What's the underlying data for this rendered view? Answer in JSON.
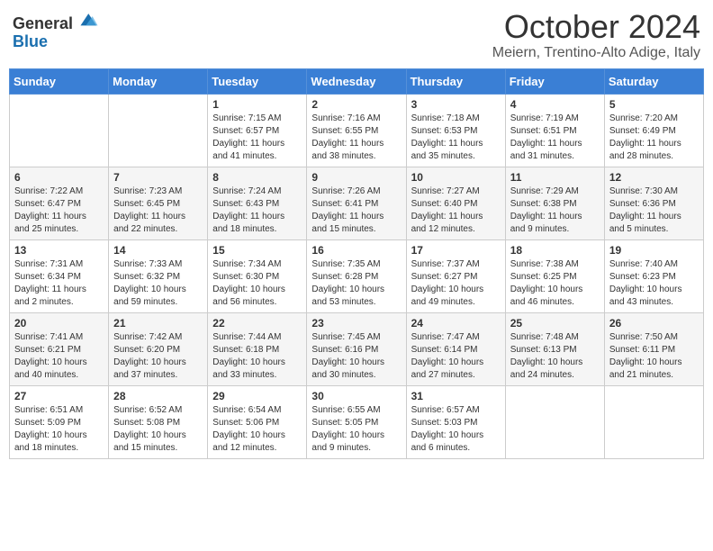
{
  "header": {
    "logo_general": "General",
    "logo_blue": "Blue",
    "month_title": "October 2024",
    "location": "Meiern, Trentino-Alto Adige, Italy"
  },
  "weekdays": [
    "Sunday",
    "Monday",
    "Tuesday",
    "Wednesday",
    "Thursday",
    "Friday",
    "Saturday"
  ],
  "weeks": [
    [
      {
        "day": "",
        "sunrise": "",
        "sunset": "",
        "daylight": ""
      },
      {
        "day": "",
        "sunrise": "",
        "sunset": "",
        "daylight": ""
      },
      {
        "day": "1",
        "sunrise": "Sunrise: 7:15 AM",
        "sunset": "Sunset: 6:57 PM",
        "daylight": "Daylight: 11 hours and 41 minutes."
      },
      {
        "day": "2",
        "sunrise": "Sunrise: 7:16 AM",
        "sunset": "Sunset: 6:55 PM",
        "daylight": "Daylight: 11 hours and 38 minutes."
      },
      {
        "day": "3",
        "sunrise": "Sunrise: 7:18 AM",
        "sunset": "Sunset: 6:53 PM",
        "daylight": "Daylight: 11 hours and 35 minutes."
      },
      {
        "day": "4",
        "sunrise": "Sunrise: 7:19 AM",
        "sunset": "Sunset: 6:51 PM",
        "daylight": "Daylight: 11 hours and 31 minutes."
      },
      {
        "day": "5",
        "sunrise": "Sunrise: 7:20 AM",
        "sunset": "Sunset: 6:49 PM",
        "daylight": "Daylight: 11 hours and 28 minutes."
      }
    ],
    [
      {
        "day": "6",
        "sunrise": "Sunrise: 7:22 AM",
        "sunset": "Sunset: 6:47 PM",
        "daylight": "Daylight: 11 hours and 25 minutes."
      },
      {
        "day": "7",
        "sunrise": "Sunrise: 7:23 AM",
        "sunset": "Sunset: 6:45 PM",
        "daylight": "Daylight: 11 hours and 22 minutes."
      },
      {
        "day": "8",
        "sunrise": "Sunrise: 7:24 AM",
        "sunset": "Sunset: 6:43 PM",
        "daylight": "Daylight: 11 hours and 18 minutes."
      },
      {
        "day": "9",
        "sunrise": "Sunrise: 7:26 AM",
        "sunset": "Sunset: 6:41 PM",
        "daylight": "Daylight: 11 hours and 15 minutes."
      },
      {
        "day": "10",
        "sunrise": "Sunrise: 7:27 AM",
        "sunset": "Sunset: 6:40 PM",
        "daylight": "Daylight: 11 hours and 12 minutes."
      },
      {
        "day": "11",
        "sunrise": "Sunrise: 7:29 AM",
        "sunset": "Sunset: 6:38 PM",
        "daylight": "Daylight: 11 hours and 9 minutes."
      },
      {
        "day": "12",
        "sunrise": "Sunrise: 7:30 AM",
        "sunset": "Sunset: 6:36 PM",
        "daylight": "Daylight: 11 hours and 5 minutes."
      }
    ],
    [
      {
        "day": "13",
        "sunrise": "Sunrise: 7:31 AM",
        "sunset": "Sunset: 6:34 PM",
        "daylight": "Daylight: 11 hours and 2 minutes."
      },
      {
        "day": "14",
        "sunrise": "Sunrise: 7:33 AM",
        "sunset": "Sunset: 6:32 PM",
        "daylight": "Daylight: 10 hours and 59 minutes."
      },
      {
        "day": "15",
        "sunrise": "Sunrise: 7:34 AM",
        "sunset": "Sunset: 6:30 PM",
        "daylight": "Daylight: 10 hours and 56 minutes."
      },
      {
        "day": "16",
        "sunrise": "Sunrise: 7:35 AM",
        "sunset": "Sunset: 6:28 PM",
        "daylight": "Daylight: 10 hours and 53 minutes."
      },
      {
        "day": "17",
        "sunrise": "Sunrise: 7:37 AM",
        "sunset": "Sunset: 6:27 PM",
        "daylight": "Daylight: 10 hours and 49 minutes."
      },
      {
        "day": "18",
        "sunrise": "Sunrise: 7:38 AM",
        "sunset": "Sunset: 6:25 PM",
        "daylight": "Daylight: 10 hours and 46 minutes."
      },
      {
        "day": "19",
        "sunrise": "Sunrise: 7:40 AM",
        "sunset": "Sunset: 6:23 PM",
        "daylight": "Daylight: 10 hours and 43 minutes."
      }
    ],
    [
      {
        "day": "20",
        "sunrise": "Sunrise: 7:41 AM",
        "sunset": "Sunset: 6:21 PM",
        "daylight": "Daylight: 10 hours and 40 minutes."
      },
      {
        "day": "21",
        "sunrise": "Sunrise: 7:42 AM",
        "sunset": "Sunset: 6:20 PM",
        "daylight": "Daylight: 10 hours and 37 minutes."
      },
      {
        "day": "22",
        "sunrise": "Sunrise: 7:44 AM",
        "sunset": "Sunset: 6:18 PM",
        "daylight": "Daylight: 10 hours and 33 minutes."
      },
      {
        "day": "23",
        "sunrise": "Sunrise: 7:45 AM",
        "sunset": "Sunset: 6:16 PM",
        "daylight": "Daylight: 10 hours and 30 minutes."
      },
      {
        "day": "24",
        "sunrise": "Sunrise: 7:47 AM",
        "sunset": "Sunset: 6:14 PM",
        "daylight": "Daylight: 10 hours and 27 minutes."
      },
      {
        "day": "25",
        "sunrise": "Sunrise: 7:48 AM",
        "sunset": "Sunset: 6:13 PM",
        "daylight": "Daylight: 10 hours and 24 minutes."
      },
      {
        "day": "26",
        "sunrise": "Sunrise: 7:50 AM",
        "sunset": "Sunset: 6:11 PM",
        "daylight": "Daylight: 10 hours and 21 minutes."
      }
    ],
    [
      {
        "day": "27",
        "sunrise": "Sunrise: 6:51 AM",
        "sunset": "Sunset: 5:09 PM",
        "daylight": "Daylight: 10 hours and 18 minutes."
      },
      {
        "day": "28",
        "sunrise": "Sunrise: 6:52 AM",
        "sunset": "Sunset: 5:08 PM",
        "daylight": "Daylight: 10 hours and 15 minutes."
      },
      {
        "day": "29",
        "sunrise": "Sunrise: 6:54 AM",
        "sunset": "Sunset: 5:06 PM",
        "daylight": "Daylight: 10 hours and 12 minutes."
      },
      {
        "day": "30",
        "sunrise": "Sunrise: 6:55 AM",
        "sunset": "Sunset: 5:05 PM",
        "daylight": "Daylight: 10 hours and 9 minutes."
      },
      {
        "day": "31",
        "sunrise": "Sunrise: 6:57 AM",
        "sunset": "Sunset: 5:03 PM",
        "daylight": "Daylight: 10 hours and 6 minutes."
      },
      {
        "day": "",
        "sunrise": "",
        "sunset": "",
        "daylight": ""
      },
      {
        "day": "",
        "sunrise": "",
        "sunset": "",
        "daylight": ""
      }
    ]
  ]
}
